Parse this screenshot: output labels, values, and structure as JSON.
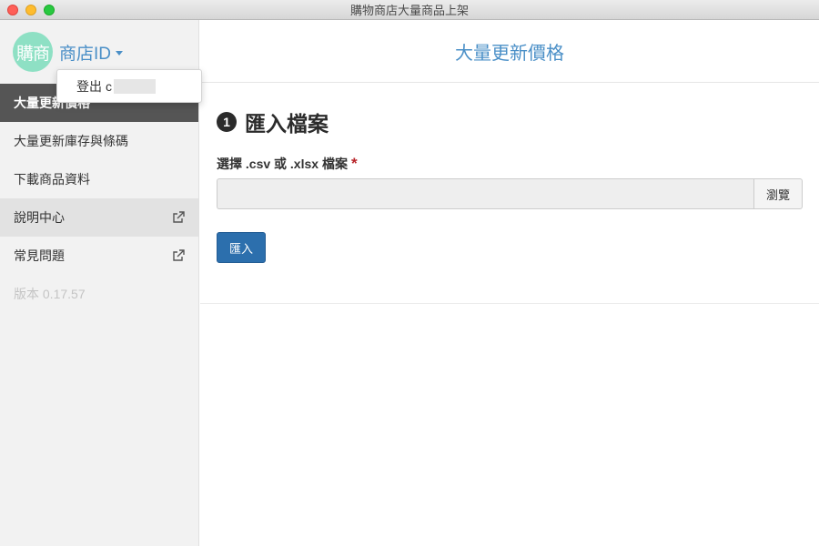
{
  "window": {
    "title": "購物商店大量商品上架"
  },
  "sidebar": {
    "avatar_text": "購商",
    "store_id_label": "商店ID",
    "items": [
      {
        "label": "大量更新價格",
        "active": true,
        "external": false
      },
      {
        "label": "大量更新庫存與條碼",
        "active": false,
        "external": false
      },
      {
        "label": "下載商品資料",
        "active": false,
        "external": false
      },
      {
        "label": "說明中心",
        "active": false,
        "external": true
      },
      {
        "label": "常見問題",
        "active": false,
        "external": true
      }
    ],
    "version": "版本 0.17.57"
  },
  "dropdown": {
    "logout_label": "登出",
    "logout_partial": "c"
  },
  "main": {
    "title": "大量更新價格",
    "step_number": "1",
    "step_heading": "匯入檔案",
    "file_label": "選擇 .csv 或 .xlsx 檔案",
    "required_mark": "*",
    "file_value": "",
    "browse_label": "瀏覽",
    "import_label": "匯入"
  },
  "colors": {
    "accent": "#4a8fc7",
    "primary_button": "#2c6fad",
    "sidebar_active": "#555555",
    "avatar_bg": "#8ee0c4",
    "required": "#b8242a"
  }
}
